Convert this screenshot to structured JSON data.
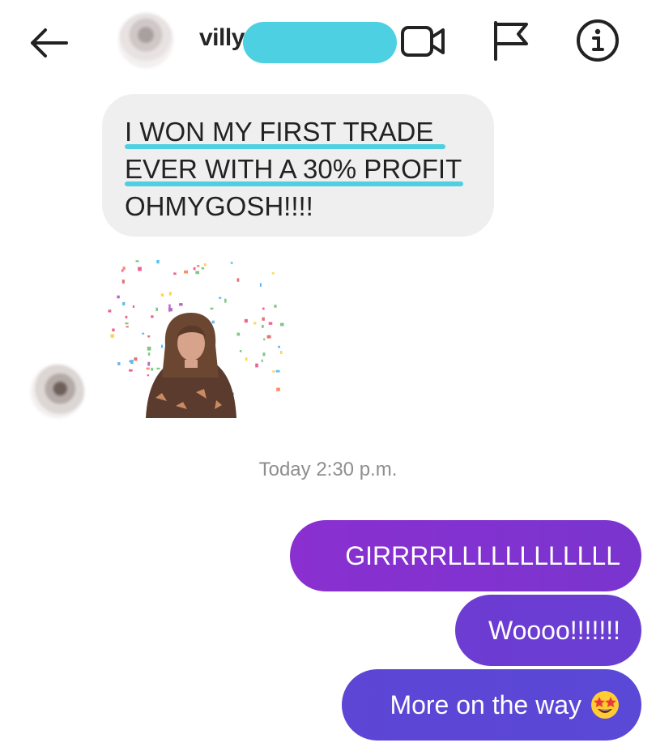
{
  "header": {
    "username": "villy",
    "back_icon": "arrow-left-icon",
    "video_icon": "video-camera-icon",
    "flag_icon": "flag-icon",
    "info_icon": "info-icon"
  },
  "messages_in": {
    "line1": "I WON MY FIRST TRADE",
    "line2": "EVER WITH A 30% PROFIT",
    "line3": "OHMYGOSH!!!!"
  },
  "timestamp": "Today 2:30 p.m.",
  "messages_out": [
    {
      "text": "GIRRRRLLLLLLLLLLLL"
    },
    {
      "text": "Woooo!!!!!!!"
    },
    {
      "text": "More on the way",
      "emoji": "star-struck-emoji"
    }
  ],
  "colors": {
    "redaction": "#4dd0e1",
    "bubble_in": "#efefef",
    "bubble_out_start": "#8a2fd0",
    "bubble_out_end": "#5a48d6",
    "timestamp": "#8e8e8e"
  }
}
